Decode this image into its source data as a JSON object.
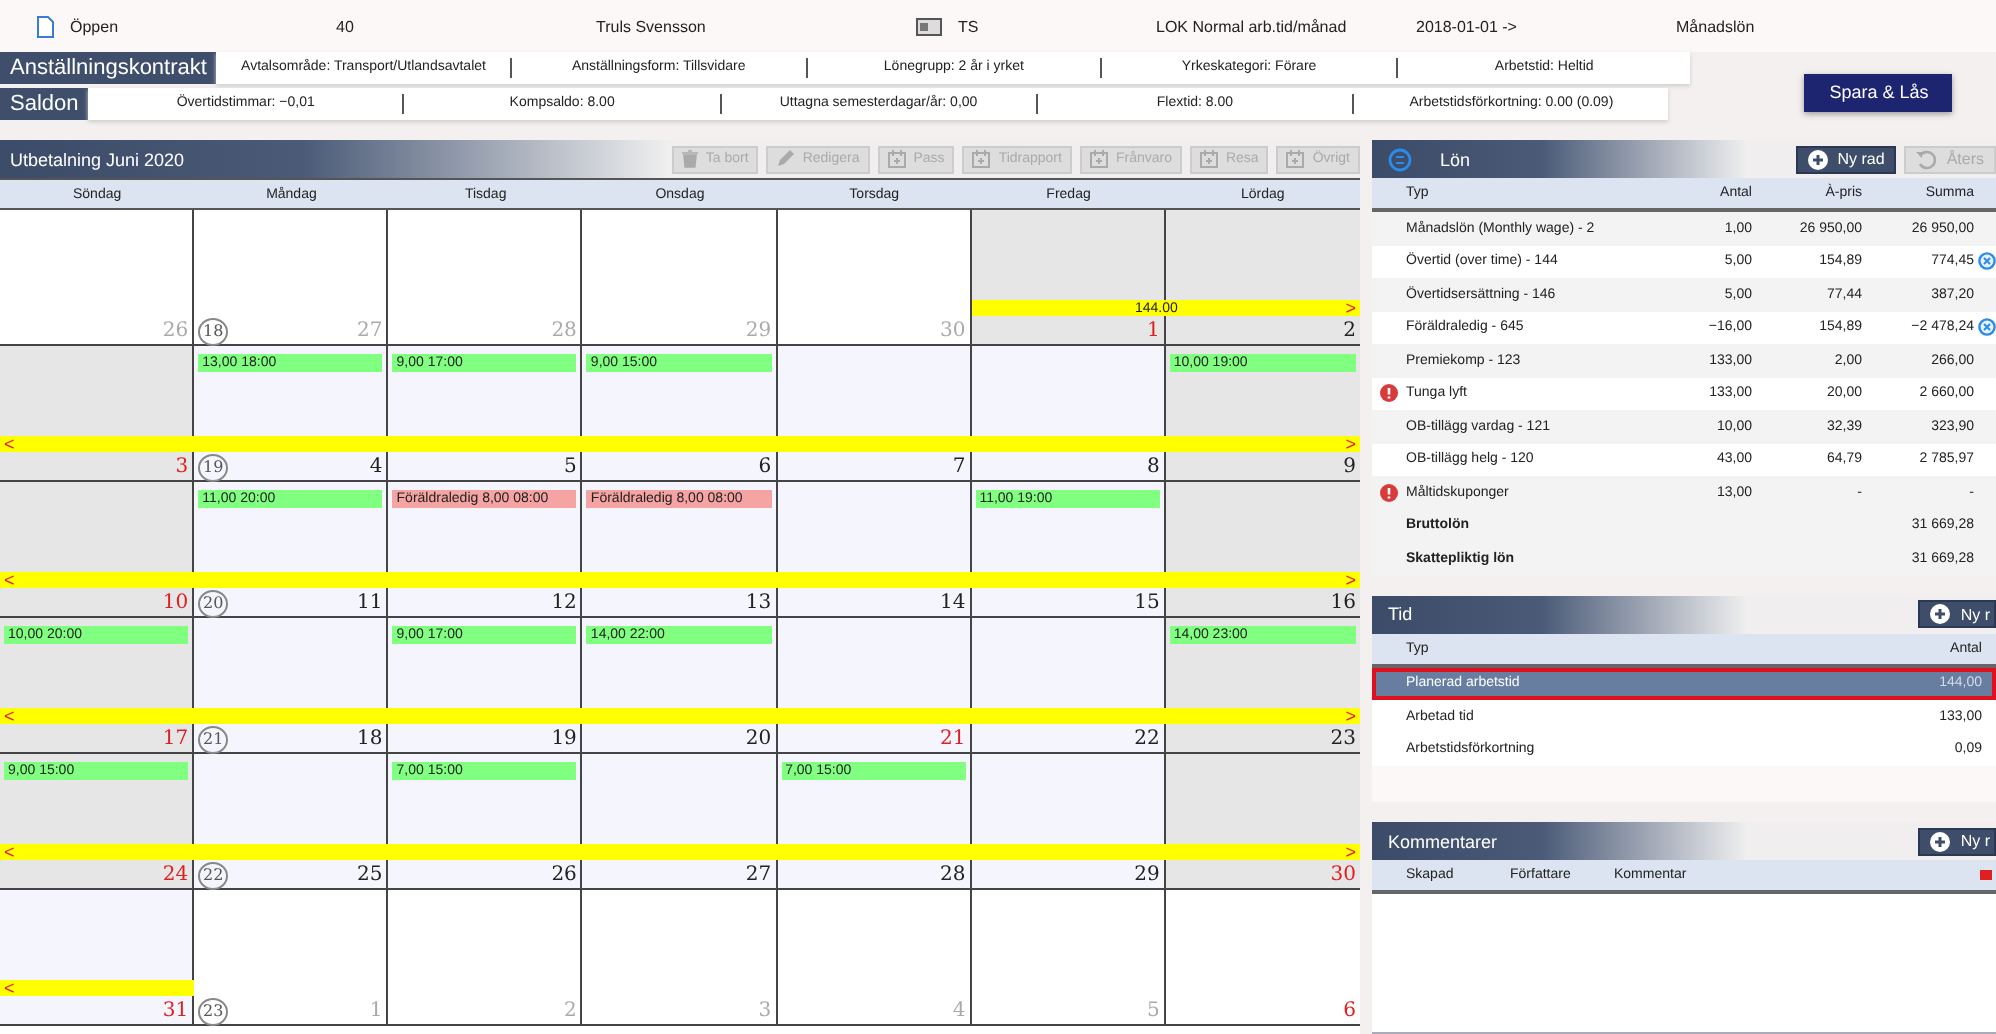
{
  "info": [
    {
      "kind": "document",
      "text": "Öppen"
    },
    {
      "kind": "plain",
      "text": "40"
    },
    {
      "kind": "plain",
      "text": "Truls Svensson"
    },
    {
      "kind": "card",
      "text": "TS"
    },
    {
      "kind": "plain",
      "text": "LOK Normal arb.tid/månad"
    },
    {
      "kind": "plain",
      "text": "2018-01-01 ->"
    },
    {
      "kind": "plain",
      "text": "Månadslön"
    }
  ],
  "contract": {
    "title": "Anställningskontrakt",
    "fields": [
      "Avtalsområde: Transport/Utlandsavtalet",
      "Anställningsform: Tillsvidare",
      "Lönegrupp: 2 år i yrket",
      "Yrkeskategori: Förare",
      "Arbetstid: Heltid"
    ]
  },
  "balances": {
    "title": "Saldon",
    "fields": [
      "Övertidstimmar: −0,01",
      "Kompsaldo: 8.00",
      "Uttagna semesterdagar/år: 0,00",
      "Flextid: 8.00",
      "Arbetstidsförkortning: 0.00 (0.09)"
    ]
  },
  "save_button": "Spara & Lås",
  "calendar": {
    "title": "Utbetalning Juni 2020",
    "toolbar": [
      {
        "label": "Ta bort",
        "disabled": true
      },
      {
        "label": "Redigera",
        "disabled": true
      },
      {
        "label": "Pass",
        "disabled": true
      },
      {
        "label": "Tidrapport",
        "disabled": true
      },
      {
        "label": "Frånvaro",
        "disabled": true
      },
      {
        "label": "Resa",
        "disabled": true
      },
      {
        "label": "Övrigt",
        "disabled": true
      }
    ],
    "weekdays": [
      "Söndag",
      "Måndag",
      "Tisdag",
      "Onsdag",
      "Torsdag",
      "Fredag",
      "Lördag"
    ],
    "weeks": [
      {
        "week": "18",
        "bar": {
          "text": "144.00",
          "right": ">"
        },
        "days": [
          {
            "day": "26",
            "outside": true,
            "shaded": false,
            "red": false,
            "in_bar": false
          },
          {
            "day": "27",
            "outside": true,
            "shaded": false,
            "red": false,
            "in_bar": false
          },
          {
            "day": "28",
            "outside": true,
            "shaded": false,
            "red": false,
            "in_bar": false
          },
          {
            "day": "29",
            "outside": true,
            "shaded": false,
            "red": false,
            "in_bar": false
          },
          {
            "day": "30",
            "outside": true,
            "shaded": false,
            "red": false,
            "in_bar": false
          },
          {
            "day": "1",
            "outside": false,
            "shaded": true,
            "red": true,
            "in_bar": true
          },
          {
            "day": "2",
            "outside": false,
            "shaded": true,
            "red": false,
            "in_bar": true
          }
        ]
      },
      {
        "week": "19",
        "bar": {
          "left": "<",
          "right": ">"
        },
        "days": [
          {
            "day": "3",
            "outside": false,
            "shaded": true,
            "red": true,
            "in_bar": true
          },
          {
            "day": "4",
            "outside": false,
            "shaded": false,
            "red": false,
            "in_bar": true,
            "events": [
              {
                "text": "13,00 18:00",
                "kind": "shift"
              }
            ]
          },
          {
            "day": "5",
            "outside": false,
            "shaded": false,
            "red": false,
            "in_bar": true,
            "events": [
              {
                "text": "9,00 17:00",
                "kind": "shift"
              }
            ]
          },
          {
            "day": "6",
            "outside": false,
            "shaded": false,
            "red": false,
            "in_bar": true,
            "events": [
              {
                "text": "9,00 15:00",
                "kind": "shift"
              }
            ]
          },
          {
            "day": "7",
            "outside": false,
            "shaded": false,
            "red": false,
            "in_bar": true
          },
          {
            "day": "8",
            "outside": false,
            "shaded": false,
            "red": false,
            "in_bar": true
          },
          {
            "day": "9",
            "outside": false,
            "shaded": true,
            "red": false,
            "in_bar": true,
            "events": [
              {
                "text": "10,00 19:00",
                "kind": "shift"
              }
            ]
          }
        ]
      },
      {
        "week": "20",
        "bar": {
          "left": "<",
          "right": ">"
        },
        "days": [
          {
            "day": "10",
            "outside": false,
            "shaded": true,
            "red": true,
            "in_bar": true
          },
          {
            "day": "11",
            "outside": false,
            "shaded": false,
            "red": false,
            "in_bar": true,
            "events": [
              {
                "text": "11,00 20:00",
                "kind": "shift"
              }
            ]
          },
          {
            "day": "12",
            "outside": false,
            "shaded": false,
            "red": false,
            "in_bar": true,
            "events": [
              {
                "text": "Föräldraledig 8,00 08:00",
                "kind": "leave"
              }
            ]
          },
          {
            "day": "13",
            "outside": false,
            "shaded": false,
            "red": false,
            "in_bar": true,
            "events": [
              {
                "text": "Föräldraledig 8,00 08:00",
                "kind": "leave"
              }
            ]
          },
          {
            "day": "14",
            "outside": false,
            "shaded": false,
            "red": false,
            "in_bar": true
          },
          {
            "day": "15",
            "outside": false,
            "shaded": false,
            "red": false,
            "in_bar": true,
            "events": [
              {
                "text": "11,00 19:00",
                "kind": "shift"
              }
            ]
          },
          {
            "day": "16",
            "outside": false,
            "shaded": true,
            "red": false,
            "in_bar": true
          }
        ]
      },
      {
        "week": "21",
        "bar": {
          "left": "<",
          "right": ">"
        },
        "days": [
          {
            "day": "17",
            "outside": false,
            "shaded": true,
            "red": true,
            "in_bar": true,
            "events": [
              {
                "text": "10,00 20:00",
                "kind": "shift"
              }
            ]
          },
          {
            "day": "18",
            "outside": false,
            "shaded": false,
            "red": false,
            "in_bar": true
          },
          {
            "day": "19",
            "outside": false,
            "shaded": false,
            "red": false,
            "in_bar": true,
            "events": [
              {
                "text": "9,00 17:00",
                "kind": "shift"
              }
            ]
          },
          {
            "day": "20",
            "outside": false,
            "shaded": false,
            "red": false,
            "in_bar": true,
            "events": [
              {
                "text": "14,00 22:00",
                "kind": "shift"
              }
            ]
          },
          {
            "day": "21",
            "outside": false,
            "shaded": false,
            "red": true,
            "in_bar": true
          },
          {
            "day": "22",
            "outside": false,
            "shaded": false,
            "red": false,
            "in_bar": true
          },
          {
            "day": "23",
            "outside": false,
            "shaded": true,
            "red": false,
            "in_bar": true,
            "events": [
              {
                "text": "14,00 23:00",
                "kind": "shift"
              }
            ]
          }
        ]
      },
      {
        "week": "22",
        "bar": {
          "left": "<",
          "right": ">"
        },
        "days": [
          {
            "day": "24",
            "outside": false,
            "shaded": true,
            "red": true,
            "in_bar": true,
            "events": [
              {
                "text": "9,00 15:00",
                "kind": "shift"
              }
            ]
          },
          {
            "day": "25",
            "outside": false,
            "shaded": false,
            "red": false,
            "in_bar": true
          },
          {
            "day": "26",
            "outside": false,
            "shaded": false,
            "red": false,
            "in_bar": true,
            "events": [
              {
                "text": "7,00 15:00",
                "kind": "shift"
              }
            ]
          },
          {
            "day": "27",
            "outside": false,
            "shaded": false,
            "red": false,
            "in_bar": true
          },
          {
            "day": "28",
            "outside": false,
            "shaded": false,
            "red": false,
            "in_bar": true,
            "events": [
              {
                "text": "7,00 15:00",
                "kind": "shift"
              }
            ]
          },
          {
            "day": "29",
            "outside": false,
            "shaded": false,
            "red": false,
            "in_bar": true
          },
          {
            "day": "30",
            "outside": false,
            "shaded": true,
            "red": true,
            "in_bar": true
          }
        ]
      },
      {
        "week": "23",
        "bar": {
          "left": "<"
        },
        "days": [
          {
            "day": "31",
            "outside": false,
            "shaded": false,
            "red": true,
            "in_bar": true
          },
          {
            "day": "1",
            "outside": true,
            "shaded": false,
            "red": false,
            "in_bar": false
          },
          {
            "day": "2",
            "outside": true,
            "shaded": false,
            "red": false,
            "in_bar": false
          },
          {
            "day": "3",
            "outside": true,
            "shaded": false,
            "red": false,
            "in_bar": false
          },
          {
            "day": "4",
            "outside": true,
            "shaded": false,
            "red": false,
            "in_bar": false
          },
          {
            "day": "5",
            "outside": true,
            "shaded": false,
            "red": false,
            "in_bar": false
          },
          {
            "day": "6",
            "outside": true,
            "shaded": false,
            "red": true,
            "in_bar": false
          }
        ]
      }
    ]
  },
  "salary": {
    "title": "Lön",
    "buttons": [
      {
        "label": "Ny rad",
        "disabled": false
      },
      {
        "label": "Åters",
        "disabled": true
      }
    ],
    "columns": [
      "Typ",
      "Antal",
      "À-pris",
      "Summa"
    ],
    "rows": [
      {
        "cells": [
          "Månadslön (Monthly wage) - 2",
          "1,00",
          "26 950,00",
          "26 950,00"
        ],
        "warning": false,
        "info": false
      },
      {
        "cells": [
          "Övertid (over time) - 144",
          "5,00",
          "154,89",
          "774,45"
        ],
        "warning": false,
        "info": true
      },
      {
        "cells": [
          "Övertidsersättning - 146",
          "5,00",
          "77,44",
          "387,20"
        ],
        "warning": false,
        "info": false
      },
      {
        "cells": [
          "Föräldraledig - 645",
          "−16,00",
          "154,89",
          "−2 478,24"
        ],
        "warning": false,
        "info": true
      },
      {
        "cells": [
          "Premiekomp - 123",
          "133,00",
          "2,00",
          "266,00"
        ],
        "warning": false,
        "info": false
      },
      {
        "cells": [
          "Tunga lyft",
          "133,00",
          "20,00",
          "2 660,00"
        ],
        "warning": true,
        "info": false
      },
      {
        "cells": [
          "OB-tillägg vardag - 121",
          "10,00",
          "32,39",
          "323,90"
        ],
        "warning": false,
        "info": false
      },
      {
        "cells": [
          "OB-tillägg helg - 120",
          "43,00",
          "64,79",
          "2 785,97"
        ],
        "warning": false,
        "info": false
      },
      {
        "cells": [
          "Måltidskuponger",
          "13,00",
          "-",
          "-"
        ],
        "warning": true,
        "info": false
      }
    ],
    "totals": [
      {
        "label": "Bruttolön",
        "value": "31 669,28"
      },
      {
        "label": "Skattepliktig lön",
        "value": "31 669,28"
      }
    ]
  },
  "time": {
    "title": "Tid",
    "button": "Ny r",
    "columns": [
      "Typ",
      "Antal"
    ],
    "rows": [
      {
        "type": "Planerad arbetstid",
        "amount": "144,00",
        "selected": true
      },
      {
        "type": "Arbetad tid",
        "amount": "133,00",
        "selected": false
      },
      {
        "type": "Arbetstidsförkortning",
        "amount": "0,09",
        "selected": false
      }
    ]
  },
  "comments": {
    "title": "Kommentarer",
    "button": "Ny r",
    "columns": [
      "Skapad",
      "Författare",
      "Kommentar"
    ]
  }
}
